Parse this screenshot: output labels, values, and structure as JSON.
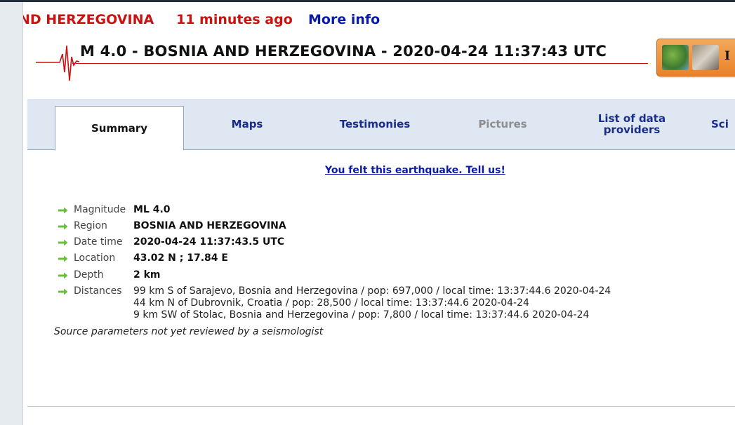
{
  "headline": {
    "region": "ND HERZEGOVINA",
    "time_ago": "11 minutes ago",
    "more_info": "More info"
  },
  "title": "M 4.0 - BOSNIA AND HERZEGOVINA - 2020-04-24 11:37:43 UTC",
  "promo": {
    "text": "I",
    "thumb1_icon": "map-thumbnail",
    "thumb2_icon": "photo-thumbnail"
  },
  "tabs": [
    {
      "label": "Summary",
      "state": "active"
    },
    {
      "label": "Maps",
      "state": "normal"
    },
    {
      "label": "Testimonies",
      "state": "normal"
    },
    {
      "label": "Pictures",
      "state": "disabled"
    },
    {
      "label": "List of data providers",
      "state": "normal"
    },
    {
      "label": "Sci",
      "state": "normal"
    }
  ],
  "felt_link": "You felt this earthquake. Tell us!",
  "details": {
    "magnitude": {
      "label": "Magnitude",
      "value": "ML 4.0"
    },
    "region": {
      "label": "Region",
      "value": "BOSNIA AND HERZEGOVINA"
    },
    "datetime": {
      "label": "Date time",
      "value": "2020-04-24 11:37:43.5 UTC"
    },
    "location": {
      "label": "Location",
      "value": "43.02 N ; 17.84 E"
    },
    "depth": {
      "label": "Depth",
      "value": "2 km"
    },
    "distances": {
      "label": "Distances",
      "lines": [
        "99 km S of Sarajevo, Bosnia and Herzegovina / pop: 697,000 / local time: 13:37:44.6 2020-04-24",
        "44 km N of Dubrovnik, Croatia / pop: 28,500 / local time: 13:37:44.6 2020-04-24",
        "9 km SW of Stolac, Bosnia and Herzegovina / pop: 7,800 / local time: 13:37:44.6 2020-04-24"
      ]
    }
  },
  "review_note": "Source parameters not yet reviewed by a seismologist",
  "colors": {
    "alert_red": "#cc1111",
    "link_blue": "#0a1aa8",
    "tab_bar": "#dfe8f2",
    "bullet_green": "#6bbf3a"
  }
}
